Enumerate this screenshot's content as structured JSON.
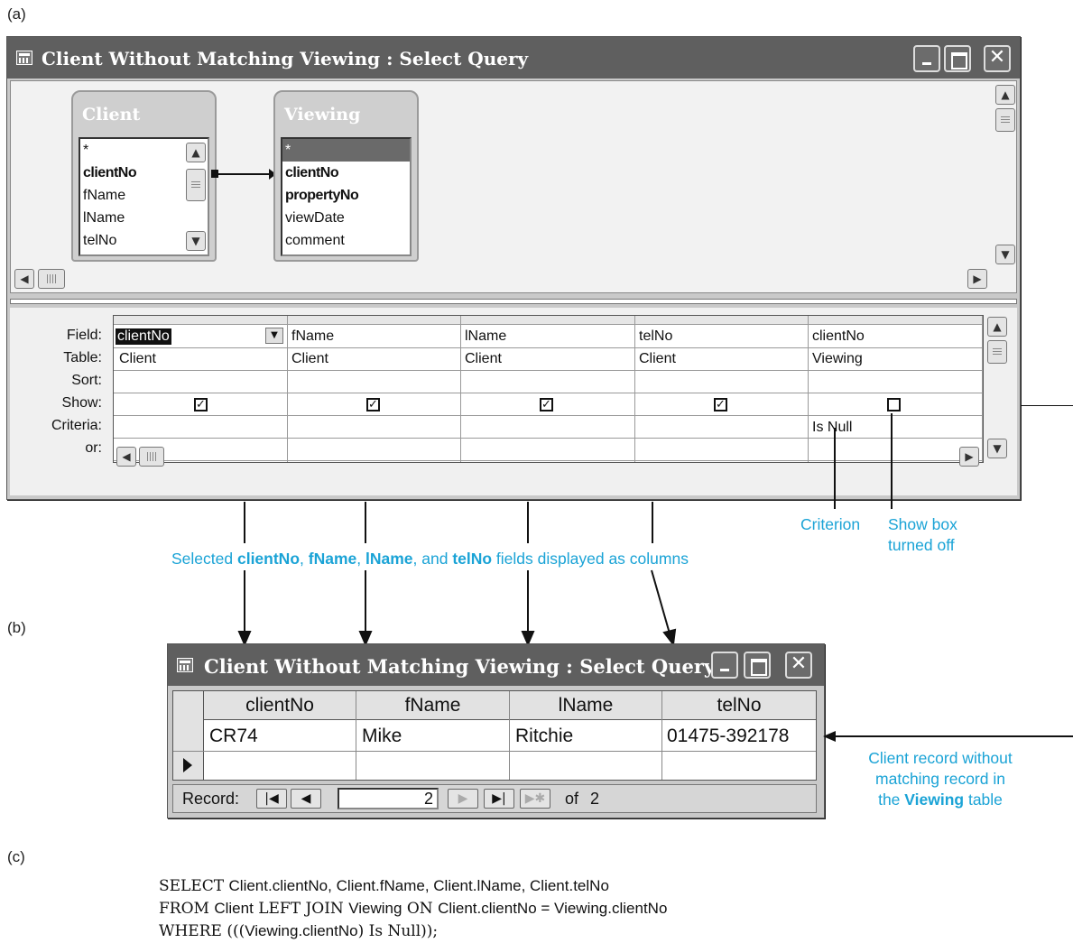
{
  "labels": {
    "a": "(a)",
    "b": "(b)",
    "c": "(c)"
  },
  "window_title": "Client Without Matching Viewing : Select Query",
  "controls": {
    "minimize": "_",
    "maximize": "□",
    "close": "✕"
  },
  "tables": [
    {
      "name": "Client",
      "fields": [
        "*",
        "clientNo",
        "fName",
        "lName",
        "telNo"
      ]
    },
    {
      "name": "Viewing",
      "fields": [
        "*",
        "clientNo",
        "propertyNo",
        "viewDate",
        "comment"
      ]
    }
  ],
  "grid": {
    "row_labels": [
      "Field:",
      "Table:",
      "Sort:",
      "Show:",
      "Criteria:",
      "or:"
    ],
    "columns": [
      {
        "field": "clientNo",
        "table": "Client",
        "show": true,
        "criteria": ""
      },
      {
        "field": "fName",
        "table": "Client",
        "show": true,
        "criteria": ""
      },
      {
        "field": "lName",
        "table": "Client",
        "show": true,
        "criteria": ""
      },
      {
        "field": "telNo",
        "table": "Client",
        "show": true,
        "criteria": ""
      },
      {
        "field": "clientNo",
        "table": "Viewing",
        "show": false,
        "criteria": "Is Null"
      }
    ]
  },
  "annotations": {
    "criterion": "Criterion",
    "show_box_1": "Show box",
    "show_box_2": "turned off",
    "selected_pre": "Selected ",
    "selected_f1": "clientNo",
    "selected_sep1": ", ",
    "selected_f2": "fName",
    "selected_sep2": ", ",
    "selected_f3": "lName",
    "selected_sep3": ", and ",
    "selected_f4": "telNo",
    "selected_post": " fields displayed as columns",
    "record_1": "Client record without",
    "record_2": "matching record in",
    "record_3_pre": "the ",
    "record_3_bold": "Viewing",
    "record_3_post": " table"
  },
  "datasheet": {
    "headers": [
      "clientNo",
      "fName",
      "lName",
      "telNo"
    ],
    "rows": [
      [
        "CR74",
        "Mike",
        "Ritchie",
        "01475-392178"
      ]
    ],
    "record_label": "Record:",
    "record_current": "2",
    "record_of": "of",
    "record_total": "2"
  },
  "sql": {
    "line1_kw": "SELECT ",
    "line1_rest": "Client.clientNo, Client.fName, Client.lName, Client.telNo",
    "line2_kw1": "FROM ",
    "line2_t1": "Client",
    "line2_kw2": " LEFT JOIN ",
    "line2_t2": "Viewing",
    "line2_kw3": " ON ",
    "line2_rest": "Client.clientNo = Viewing.clientNo",
    "line3_kw": "WHERE (((",
    "line3_rest": "Viewing.clientNo",
    "line3_end": ") Is Null));"
  }
}
